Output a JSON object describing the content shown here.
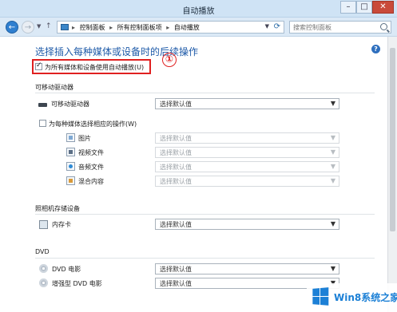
{
  "window": {
    "title": "自动播放",
    "minimize": "–",
    "maximize": "□",
    "close": "✕"
  },
  "nav": {
    "back": "←",
    "forward": "→",
    "up": "↑",
    "breadcrumbs": [
      "控制面板",
      "所有控制面板项",
      "自动播放"
    ],
    "search_placeholder": "搜索控制面板"
  },
  "page": {
    "title": "选择插入每种媒体或设备时的后续操作",
    "help": "?",
    "use_autoplay_label": "为所有媒体和设备使用自动播放(U)",
    "use_autoplay_checked": true,
    "annotation": "①"
  },
  "sections": {
    "removable": {
      "header": "可移动驱动器",
      "drive_label": "可移动驱动器",
      "drive_value": "选择默认值",
      "per_media_label": "为每种媒体选择相应的操作(W)",
      "per_media_checked": false,
      "media": [
        {
          "label": "图片",
          "value": "选择默认值",
          "icon": "picture-file-icon"
        },
        {
          "label": "视频文件",
          "value": "选择默认值",
          "icon": "video-file-icon"
        },
        {
          "label": "音频文件",
          "value": "选择默认值",
          "icon": "audio-file-icon"
        },
        {
          "label": "混合内容",
          "value": "选择默认值",
          "icon": "mixed-file-icon"
        }
      ]
    },
    "camera": {
      "header": "照相机存储设备",
      "card_label": "内存卡",
      "card_value": "选择默认值"
    },
    "dvd": {
      "header": "DVD",
      "items": [
        {
          "label": "DVD 电影",
          "value": "选择默认值"
        },
        {
          "label": "增强型 DVD 电影",
          "value": "选择默认值"
        }
      ]
    }
  },
  "watermark": {
    "text": "Win8系统之家"
  }
}
